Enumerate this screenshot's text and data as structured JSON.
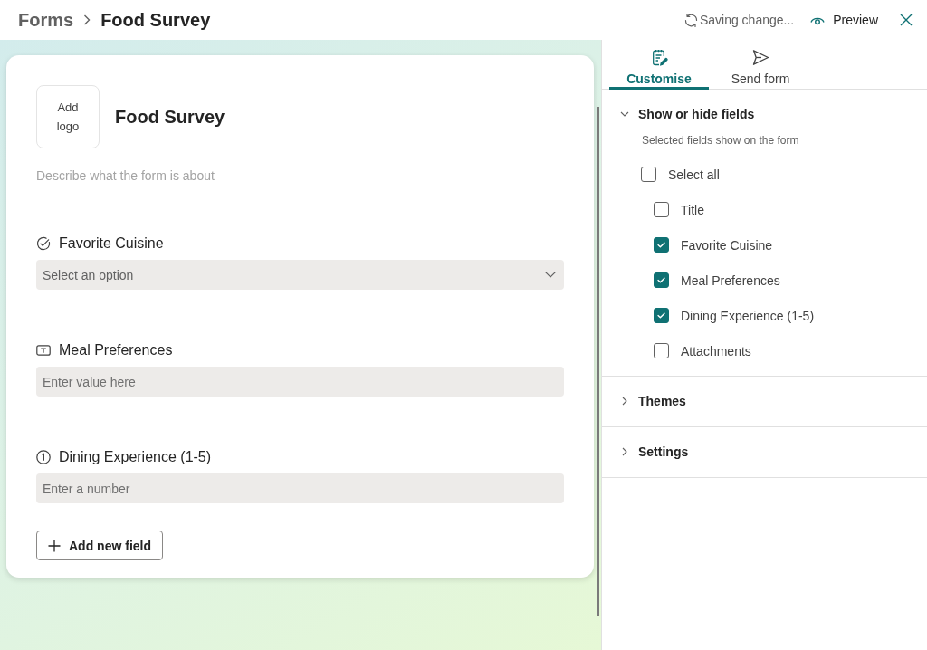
{
  "header": {
    "breadcrumb": [
      {
        "label": "Forms"
      },
      {
        "label": "Food Survey"
      }
    ],
    "status": "Saving change...",
    "preview_button": "Preview"
  },
  "form": {
    "logo_button": "Add logo",
    "title": "Food Survey",
    "description": {
      "placeholder": "Describe what the form is about"
    },
    "fields": [
      {
        "kind": "choice",
        "label": "Favorite Cuisine",
        "placeholder": "Select an option"
      },
      {
        "kind": "text",
        "label": "Meal Preferences",
        "placeholder": "Enter value here"
      },
      {
        "kind": "number",
        "label": "Dining Experience (1-5)",
        "placeholder": "Enter a number"
      }
    ],
    "add_button": "Add new field"
  },
  "panel": {
    "tabs": [
      {
        "label": "Customise",
        "selected": true
      },
      {
        "label": "Send form",
        "selected": false
      }
    ],
    "sections": [
      {
        "title": "Show or hide fields",
        "expanded": true,
        "description": "Selected fields show on the form",
        "select_all": {
          "label": "Select all",
          "checked": false
        },
        "items": [
          {
            "label": "Title",
            "checked": false
          },
          {
            "label": "Favorite Cuisine",
            "checked": true
          },
          {
            "label": "Meal Preferences",
            "checked": true
          },
          {
            "label": "Dining Experience (1-5)",
            "checked": true
          },
          {
            "label": "Attachments",
            "checked": false
          }
        ]
      },
      {
        "title": "Themes",
        "expanded": false
      },
      {
        "title": "Settings",
        "expanded": false
      }
    ]
  }
}
